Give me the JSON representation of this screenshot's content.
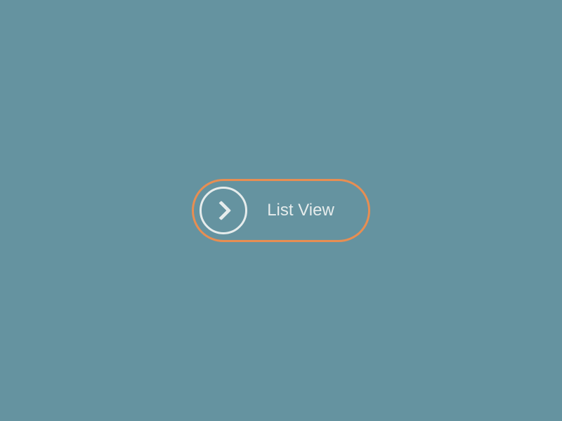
{
  "button": {
    "label": "List View"
  }
}
